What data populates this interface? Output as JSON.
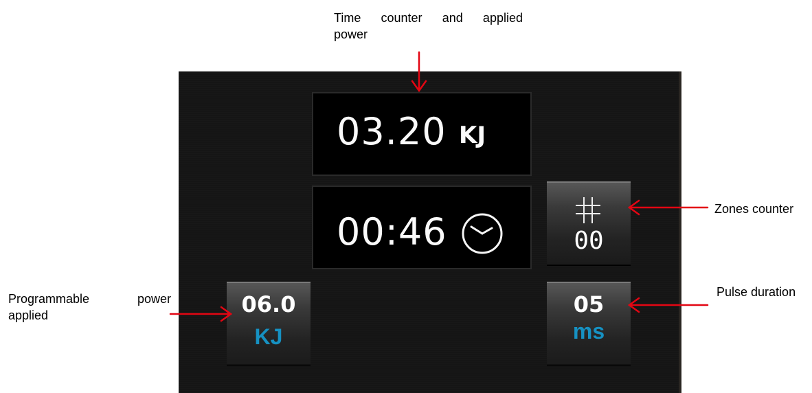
{
  "annotations": {
    "top": {
      "line1": "Time counter and applied",
      "line2": "power"
    },
    "zones": "Zones counter",
    "power": {
      "line1": "Programmable power",
      "line2": "applied"
    },
    "pulse": "Pulse duration"
  },
  "screen": {
    "energy_display": {
      "value": "03.20",
      "unit": "KJ"
    },
    "time_display": {
      "value": "00:46",
      "icon": "clock-icon"
    },
    "zones_button": {
      "icon": "grid-icon",
      "value": "00"
    },
    "power_button": {
      "value": "06.0",
      "unit": "KJ"
    },
    "pulse_button": {
      "value": "05",
      "unit": "ms"
    }
  },
  "colors": {
    "arrow": "#e30613",
    "accent_unit": "#1691c2",
    "screen_bg": "#151515"
  }
}
